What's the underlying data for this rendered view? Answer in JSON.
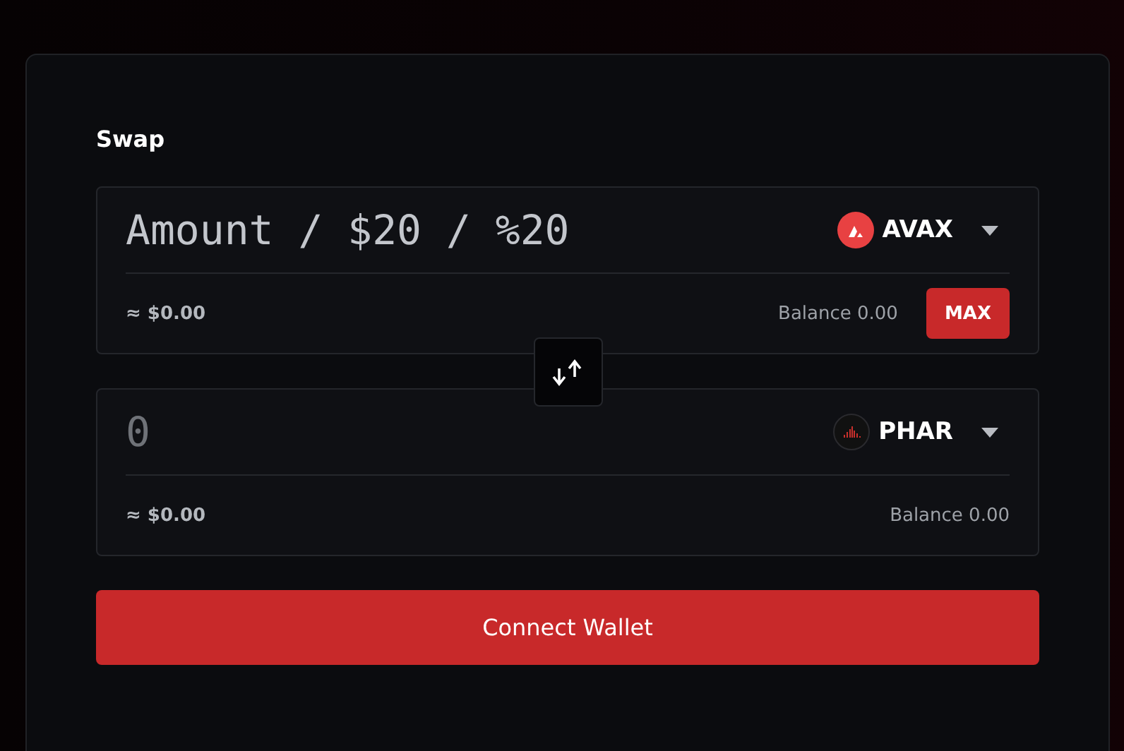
{
  "title": "Swap",
  "fields": [
    {
      "placeholder": "Amount / $20 / %20",
      "token": {
        "symbol": "AVAX",
        "kind": "avax"
      },
      "usd": "≈ $0.00",
      "balance_label": "Balance",
      "balance": "0.00",
      "max_button": "MAX"
    },
    {
      "placeholder": "0",
      "token": {
        "symbol": "PHAR",
        "kind": "phar"
      },
      "usd": "≈ $0.00",
      "balance_label": "Balance",
      "balance": "0.00"
    }
  ],
  "connect_button": "Connect Wallet"
}
